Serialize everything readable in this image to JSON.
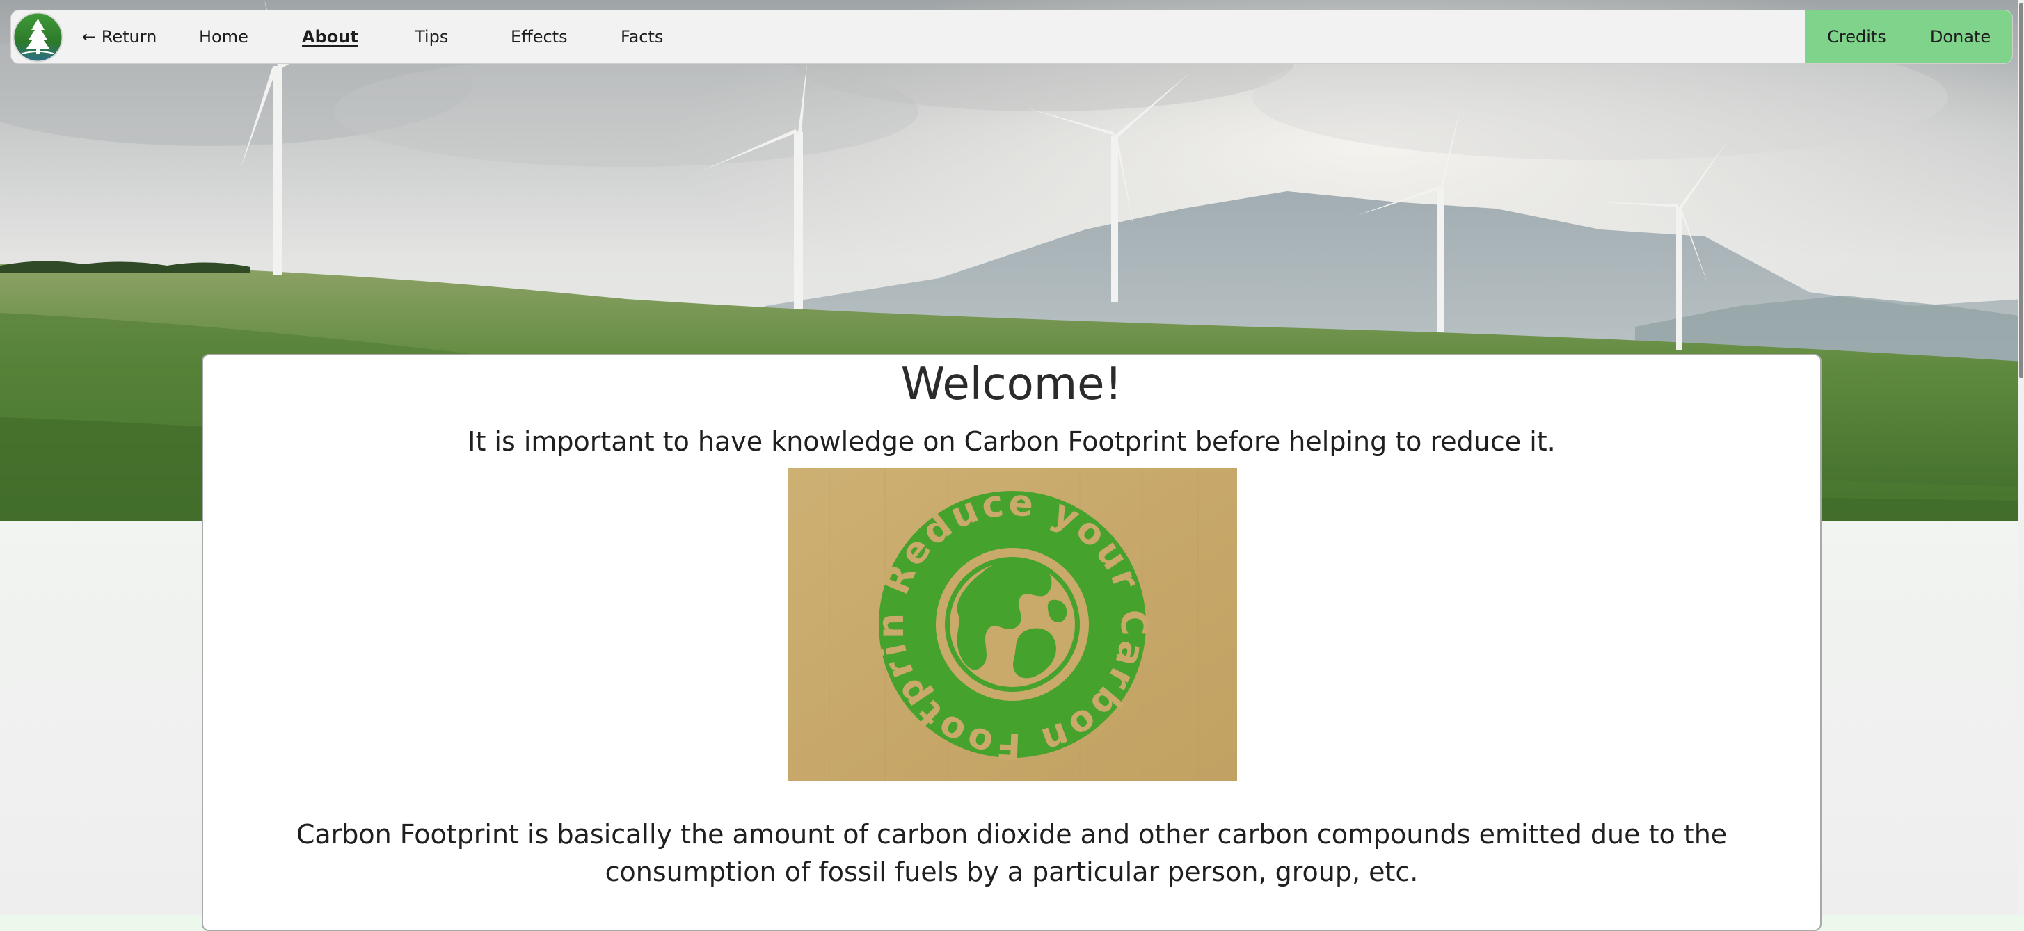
{
  "nav": {
    "return_label": "← Return",
    "items": [
      {
        "label": "Home"
      },
      {
        "label": "About",
        "active": true
      },
      {
        "label": "Tips"
      },
      {
        "label": "Effects"
      },
      {
        "label": "Facts"
      }
    ],
    "right_items": [
      {
        "label": "Credits"
      },
      {
        "label": "Donate"
      }
    ]
  },
  "main": {
    "title": "Welcome!",
    "subtitle": "It is important to have knowledge on Carbon Footprint before helping to reduce it.",
    "image": {
      "text": "Reduce your Carbon Footprint"
    },
    "paragraph": "Carbon Footprint is basically the amount of carbon dioxide and other carbon compounds emitted due to the consumption of fossil fuels by a particular person, group, etc."
  },
  "colors": {
    "nav_right_bg": "#7fd38b",
    "sticker_green": "#45a22c",
    "cardboard": "#c9aa6a"
  }
}
